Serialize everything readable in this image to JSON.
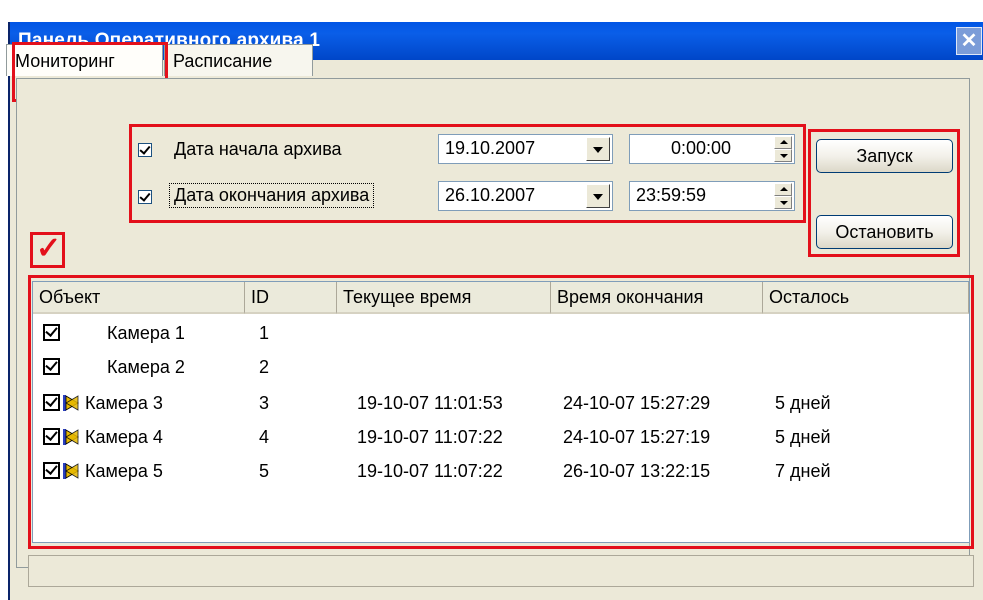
{
  "window": {
    "title": "Панель Оперативного архива 1",
    "close_glyph": "✕"
  },
  "tabs": [
    {
      "label": "Мониторинг",
      "active": true
    },
    {
      "label": "Расписание",
      "active": false
    }
  ],
  "range": {
    "start": {
      "label": "Дата начала архива",
      "checked": true,
      "date": "19.10.2007",
      "time": "0:00:00"
    },
    "end": {
      "label": "Дата окончания архива",
      "checked": true,
      "date": "26.10.2007",
      "time": "23:59:59"
    }
  },
  "buttons": {
    "start": "Запуск",
    "stop": "Остановить"
  },
  "annotation": {
    "mark_glyph": "✓",
    "highlight_color": "#e3101b"
  },
  "table": {
    "columns": [
      "Объект",
      "ID",
      "Текущее время",
      "Время окончания",
      "Осталось"
    ],
    "rows": [
      {
        "checked": true,
        "icon": false,
        "name": "Камера 1",
        "id": "1",
        "current": "",
        "end": "",
        "left": ""
      },
      {
        "checked": true,
        "icon": false,
        "name": "Камера 2",
        "id": "2",
        "current": "",
        "end": "",
        "left": ""
      },
      {
        "checked": true,
        "icon": true,
        "name": "Камера 3",
        "id": "3",
        "current": "19-10-07 11:01:53",
        "end": "24-10-07 15:27:29",
        "left": "5 дней"
      },
      {
        "checked": true,
        "icon": true,
        "name": "Камера 4",
        "id": "4",
        "current": "19-10-07 11:07:22",
        "end": "24-10-07 15:27:19",
        "left": "5 дней"
      },
      {
        "checked": true,
        "icon": true,
        "name": "Камера 5",
        "id": "5",
        "current": "19-10-07 11:07:22",
        "end": "26-10-07 13:22:15",
        "left": "7 дней"
      }
    ]
  },
  "icons": {
    "camera_recording": "camera-recording-icon",
    "checkbox": "checkbox-icon"
  }
}
